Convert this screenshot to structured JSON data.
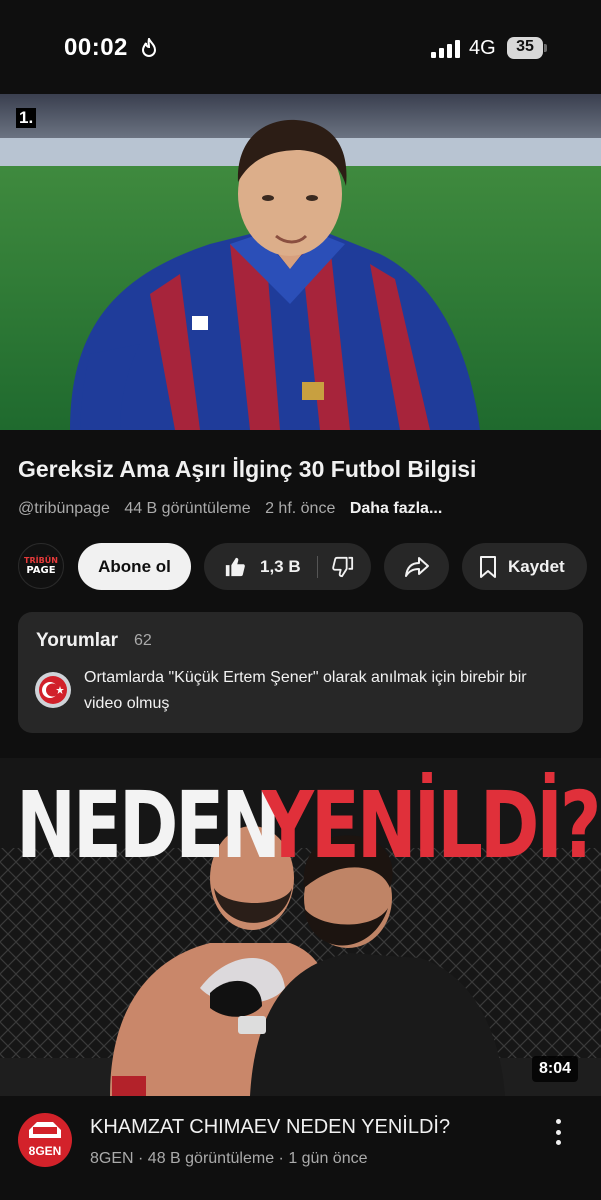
{
  "status_bar": {
    "time": "00:02",
    "network": "4G",
    "battery": "35"
  },
  "player": {
    "rank_badge": "1."
  },
  "video": {
    "title": "Gereksiz Ama Aşırı İlginç 30 Futbol Bilgisi",
    "channel_handle": "@tribünpage",
    "views": "44 B görüntüleme",
    "age": "2 hf. önce",
    "more_label": "Daha fazla..."
  },
  "channel": {
    "avatar_text_line1": "TRİBÜN",
    "avatar_text_line2": "PAGE"
  },
  "actions": {
    "subscribe_label": "Abone ol",
    "like_count": "1,3 B",
    "save_label": "Kaydet"
  },
  "comments": {
    "header": "Yorumlar",
    "count": "62",
    "top_comment": "Ortamlarda \"Küçük Ertem Şener\" olarak anılmak için birebir bir video olmuş"
  },
  "next_video": {
    "thumb_word1": "NEDEN",
    "thumb_word2": "YENİLDİ?",
    "duration": "8:04",
    "channel_avatar_text": "8GEN",
    "title": "KHAMZAT CHIMAEV NEDEN YENİLDİ?",
    "meta": "8GEN · 48 B görüntüleme · 1 gün önce"
  },
  "colors": {
    "background": "#0f0f0f",
    "pill": "#272727",
    "subscribe_bg": "#f1f1f1",
    "thumb_red": "#e0303a",
    "channel_red": "#d3222a"
  }
}
